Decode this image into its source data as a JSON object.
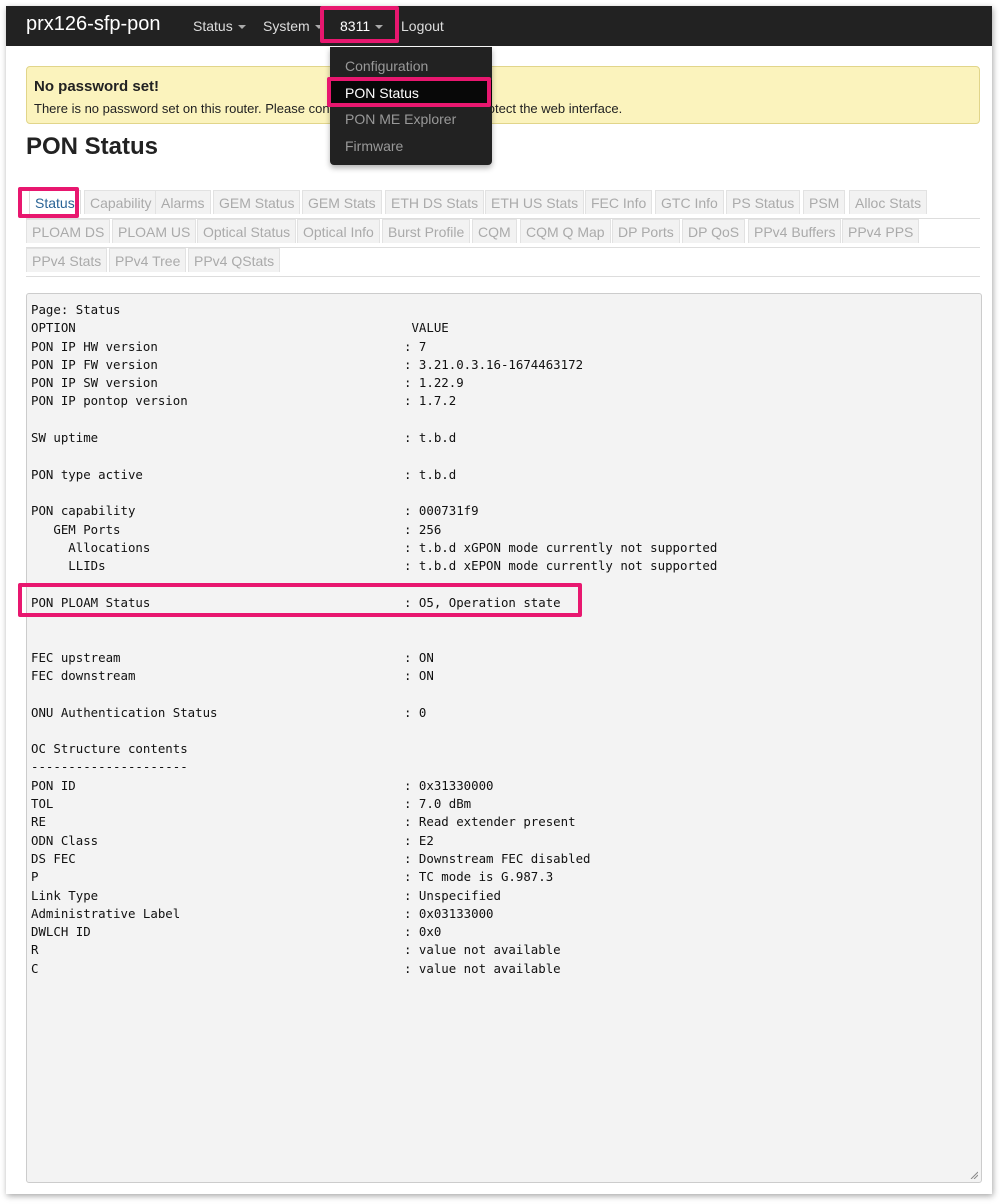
{
  "navbar": {
    "brand": "prx126-sfp-pon",
    "items": [
      {
        "label": "Status",
        "caret": true
      },
      {
        "label": "System",
        "caret": true
      },
      {
        "label": "8311",
        "caret": true
      },
      {
        "label": "Logout",
        "caret": false
      }
    ]
  },
  "dropdown": {
    "items": [
      {
        "label": "Configuration"
      },
      {
        "label": "PON Status"
      },
      {
        "label": "PON ME Explorer"
      },
      {
        "label": "Firmware"
      }
    ],
    "active": "PON Status"
  },
  "alert": {
    "title": "No password set!",
    "text": "There is no password set on this router. Please configure a root password to protect the web interface."
  },
  "page": {
    "title": "PON Status"
  },
  "tabs": {
    "row1": [
      "Status",
      "Capability",
      "Alarms",
      "GEM Status",
      "GEM Stats",
      "ETH DS Stats",
      "ETH US Stats",
      "FEC Info",
      "GTC Info",
      "PS Status",
      "PSM",
      "Alloc Stats"
    ],
    "row2": [
      "PLOAM DS",
      "PLOAM US",
      "Optical Status",
      "Optical Info",
      "Burst Profile",
      "CQM",
      "CQM Q Map",
      "DP Ports",
      "DP QoS",
      "PPv4 Buffers",
      "PPv4 PPS"
    ],
    "row3": [
      "PPv4 Stats",
      "PPv4 Tree",
      "PPv4 QStats"
    ],
    "active": "Status"
  },
  "output": {
    "text": "Page: Status\nOPTION                                             VALUE\nPON IP HW version                                 : 7\nPON IP FW version                                 : 3.21.0.3.16-1674463172\nPON IP SW version                                 : 1.22.9\nPON IP pontop version                             : 1.7.2\n\nSW uptime                                         : t.b.d\n\nPON type active                                   : t.b.d\n\nPON capability                                    : 000731f9\n   GEM Ports                                      : 256\n     Allocations                                  : t.b.d xGPON mode currently not supported\n     LLIDs                                        : t.b.d xEPON mode currently not supported\n\nPON PLOAM Status                                  : O5, Operation state\n\n\nFEC upstream                                      : ON\nFEC downstream                                    : ON\n\nONU Authentication Status                         : 0\n\nOC Structure contents\n---------------------\nPON ID                                            : 0x31330000\nTOL                                               : 7.0 dBm\nRE                                                : Read extender present\nODN Class                                         : E2\nDS FEC                                            : Downstream FEC disabled\nP                                                 : TC mode is G.987.3\nLink Type                                         : Unspecified\nAdministrative Label                              : 0x03133000\nDWLCH ID                                          : 0x0\nR                                                 : value not available\nC                                                 : value not available"
  },
  "colors": {
    "highlight": "#e8176f",
    "navbar": "#222222",
    "alert_bg": "#fbf3bd",
    "active_tab_text": "#2a6496"
  }
}
